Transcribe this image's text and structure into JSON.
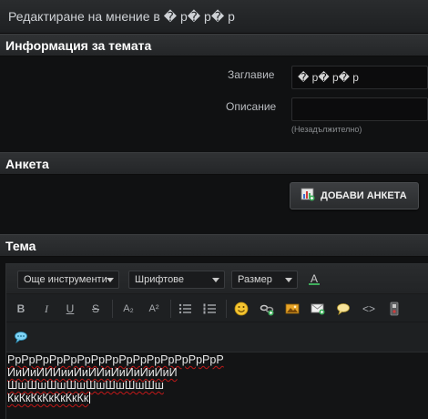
{
  "window": {
    "title": "Редактиране на мнение в � р� р� р"
  },
  "topic_info": {
    "heading": "Информация за темата",
    "title_label": "Заглавие",
    "title_value": "� р� р� р",
    "description_label": "Описание",
    "description_value": "",
    "optional_hint": "(Незадължително)"
  },
  "poll": {
    "heading": "Анкета",
    "add_button": "ДОБАВИ АНКЕТА"
  },
  "topic": {
    "heading": "Тема",
    "toolbar": {
      "other_tools": "Още инструменти",
      "fonts": "Шрифтове",
      "size": "Размер",
      "font_color_glyph": "A",
      "bold": "B",
      "italic": "I",
      "underline": "U",
      "strike": "S",
      "subscript": "A₂",
      "superscript": "A²",
      "code_glyph": "<>"
    },
    "body_lines": [
      "РрРрРрРрРрРрРрРрРрРрРрРрРрРрРрР",
      "ИиИиИИИииИиИИиИиИиИиИиИ",
      "ШшШшШшШшШшШшШшШш",
      "КкКкКкКкКкКкКк"
    ]
  },
  "colors": {
    "background": "#101112",
    "header": "#242628",
    "accent_green": "#3fae5c"
  }
}
